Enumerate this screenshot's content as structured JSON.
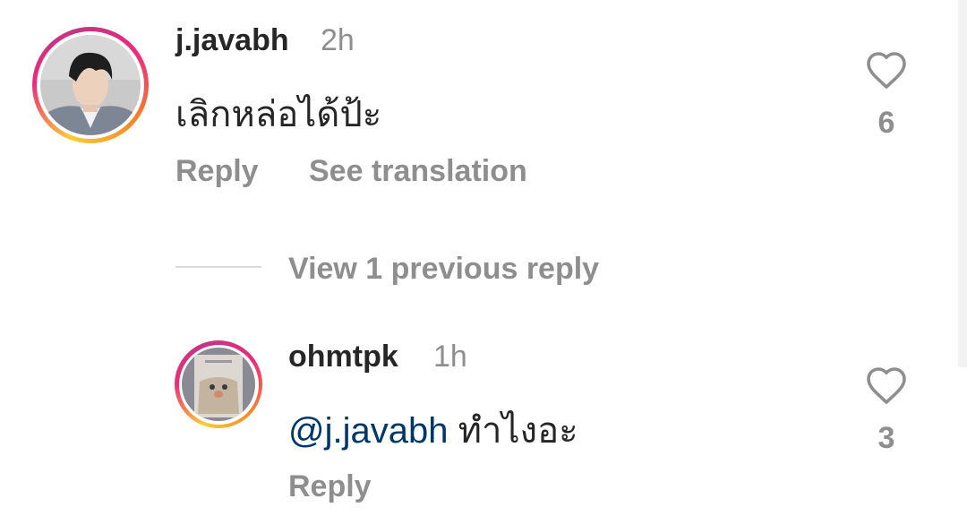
{
  "comments": [
    {
      "username": "j.javabh",
      "time": "2h",
      "text": "เลิกหล่อได้ป้ะ",
      "like_count": "6",
      "reply_label": "Reply",
      "translate_label": "See translation",
      "avatar": "user-photo"
    }
  ],
  "view_replies_label": "View 1 previous reply",
  "replies": [
    {
      "username": "ohmtpk",
      "time": "1h",
      "mention": "@j.javabh",
      "text": "ทำไงอะ",
      "like_count": "3",
      "reply_label": "Reply",
      "avatar": "cookie-photo"
    }
  ],
  "colors": {
    "mention": "#00376b",
    "secondary_text": "#8e8e8e",
    "primary_text": "#262626"
  },
  "icons": {
    "like": "heart-outline-icon"
  }
}
